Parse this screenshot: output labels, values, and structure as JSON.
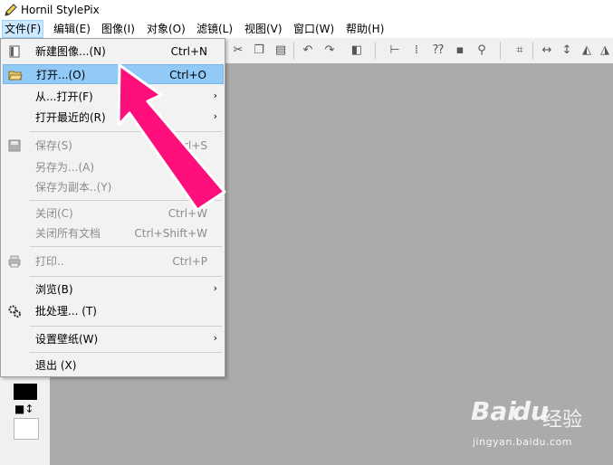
{
  "window": {
    "title": "Hornil StylePix",
    "app_icon": "pencil-icon"
  },
  "menubar": {
    "items": [
      {
        "label": "文件(F)"
      },
      {
        "label": "编辑(E)"
      },
      {
        "label": "图像(I)"
      },
      {
        "label": "对象(O)"
      },
      {
        "label": "滤镜(L)"
      },
      {
        "label": "视图(V)"
      },
      {
        "label": "窗口(W)"
      },
      {
        "label": "帮助(H)"
      }
    ]
  },
  "file_menu": {
    "items": [
      {
        "label": "新建图像...(N)",
        "shortcut": "Ctrl+N",
        "icon": "new-image-icon",
        "enabled": true
      },
      {
        "label": "打开...(O)",
        "shortcut": "Ctrl+O",
        "icon": "open-folder-icon",
        "enabled": true,
        "highlighted": true
      },
      {
        "label": "从...打开(F)",
        "shortcut": "",
        "submenu": true,
        "enabled": true
      },
      {
        "label": "打开最近的(R)",
        "shortcut": "",
        "submenu": true,
        "enabled": true
      },
      {
        "label": "保存(S)",
        "shortcut": "Ctrl+S",
        "icon": "save-icon",
        "enabled": false
      },
      {
        "label": "另存为...(A)",
        "shortcut": "",
        "enabled": false
      },
      {
        "label": "保存为副本..(Y)",
        "shortcut": "",
        "enabled": false
      },
      {
        "label": "关闭(C)",
        "shortcut": "Ctrl+W",
        "enabled": false
      },
      {
        "label": "关闭所有文档",
        "shortcut": "Ctrl+Shift+W",
        "enabled": false
      },
      {
        "label": "打印..",
        "shortcut": "Ctrl+P",
        "icon": "printer-icon",
        "enabled": false
      },
      {
        "label": "浏览(B)",
        "shortcut": "",
        "submenu": true,
        "enabled": true
      },
      {
        "label": "批处理... (T)",
        "shortcut": "",
        "icon": "gears-icon",
        "enabled": true
      },
      {
        "label": "设置壁纸(W)",
        "shortcut": "",
        "submenu": true,
        "enabled": true
      },
      {
        "label": "退出 (X)",
        "shortcut": "",
        "enabled": true
      }
    ],
    "submenu_glyph": "›"
  },
  "palette": {
    "foreground": "#000000",
    "background": "#ffffff",
    "swap_glyph": "■↕"
  },
  "watermark": {
    "logo": "Bai",
    "paw": "du",
    "cn": "经验",
    "url": "jingyan.baidu.com"
  },
  "colors": {
    "highlight": "#91c9f7",
    "arrow": "#ff0f7b",
    "canvas": "#ababab"
  }
}
